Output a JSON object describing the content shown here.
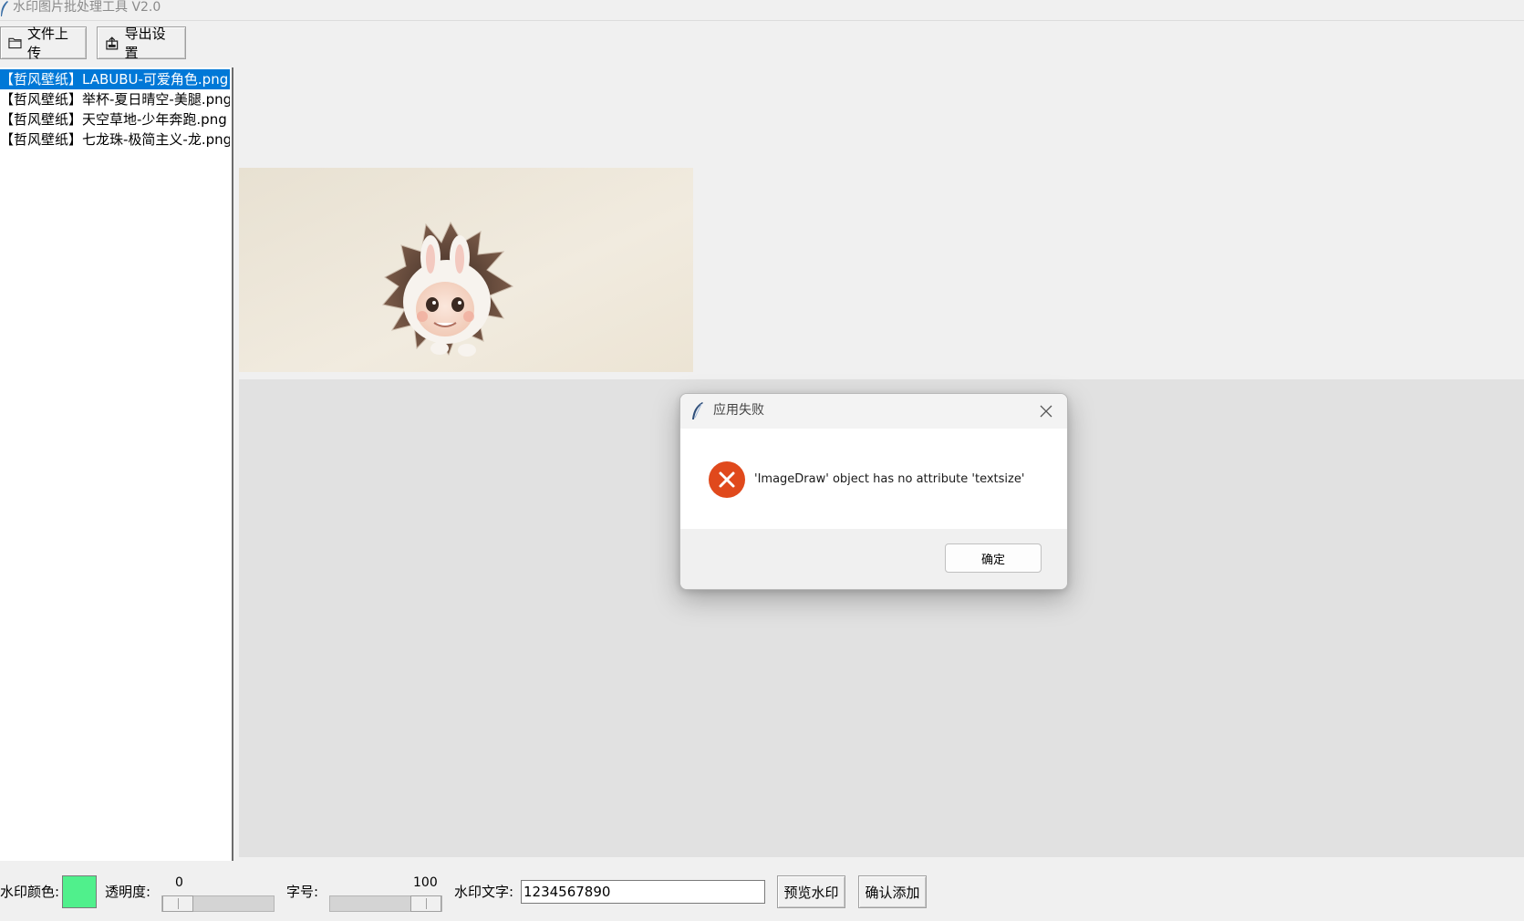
{
  "window": {
    "title": "水印图片批处理工具 V2.0"
  },
  "toolbar": {
    "upload_label": "文件上传",
    "export_label": "导出设置"
  },
  "file_list": {
    "items": [
      {
        "label": "【哲风壁纸】LABUBU-可爱角色.png",
        "selected": true
      },
      {
        "label": "【哲风壁纸】举杯-夏日晴空-美腿.png",
        "selected": false
      },
      {
        "label": "【哲风壁纸】天空草地-少年奔跑.png",
        "selected": false
      },
      {
        "label": "【哲风壁纸】七龙珠-极简主义-龙.png",
        "selected": false
      }
    ]
  },
  "dialog": {
    "title": "应用失败",
    "message": "'ImageDraw' object has no attribute 'textsize'",
    "ok_label": "确定"
  },
  "controls": {
    "color_label": "水印颜色:",
    "color_value": "#50f08c",
    "opacity_label": "透明度:",
    "opacity_value": "0",
    "font_size_label": "字号:",
    "font_size_value": "100",
    "text_label": "水印文字:",
    "text_value": "1234567890",
    "preview_label": "预览水印",
    "confirm_label": "确认添加"
  },
  "colors": {
    "selection": "#0078d7",
    "error_icon": "#e0491c"
  }
}
